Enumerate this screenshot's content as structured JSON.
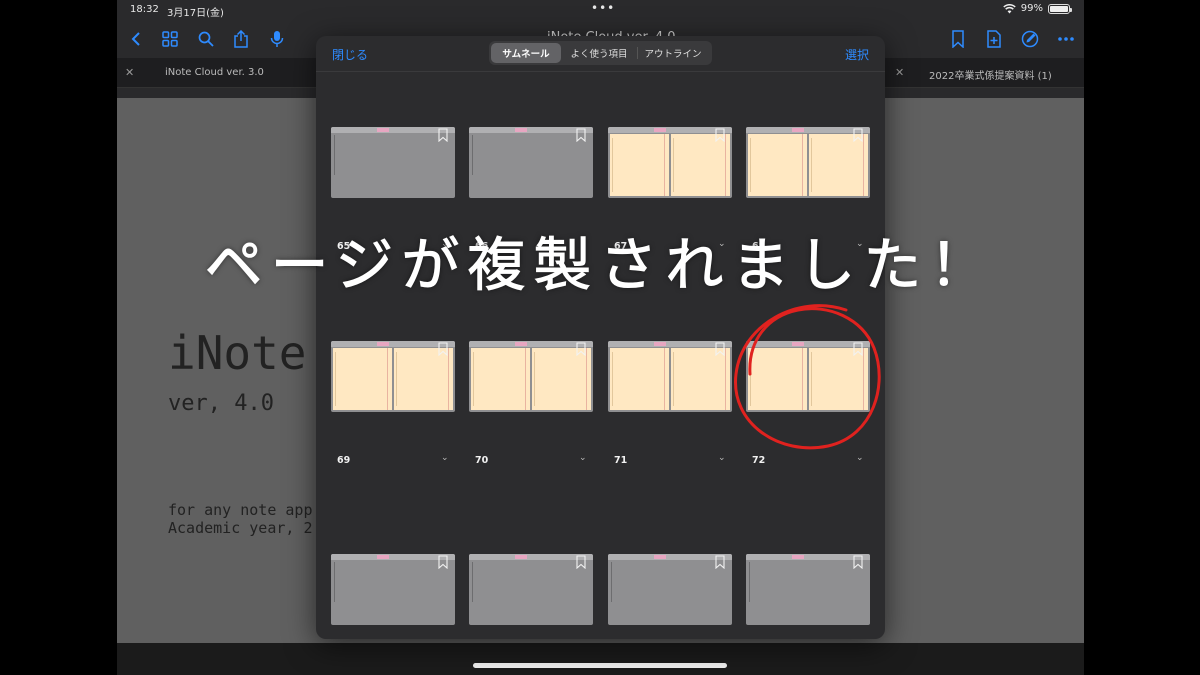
{
  "status": {
    "time": "18:32",
    "date": "3月17日(金)",
    "battery": "99%",
    "battery_level": 0.99
  },
  "toolbar": {
    "title": "iNote Cloud ver. 4.0"
  },
  "tabs": [
    {
      "label": "iNote Cloud ver. 3.0"
    },
    {
      "label": "2022卒業式係提案資料 (1)"
    }
  ],
  "document": {
    "title": "iNote",
    "version": "ver, 4.0",
    "line1": "for any note app",
    "line2": "Academic year, 2"
  },
  "panel": {
    "close_label": "閉じる",
    "select_label": "選択",
    "segments": [
      "サムネール",
      "よく使う項目",
      "アウトライン"
    ],
    "active_segment": "サムネール"
  },
  "thumbnails": [
    {
      "page": "65",
      "type": "gray"
    },
    {
      "page": "66",
      "type": "gray"
    },
    {
      "page": "67",
      "type": "spread"
    },
    {
      "page": "68",
      "type": "spread"
    },
    {
      "page": "69",
      "type": "spread"
    },
    {
      "page": "70",
      "type": "spread"
    },
    {
      "page": "71",
      "type": "spread"
    },
    {
      "page": "72",
      "type": "spread",
      "circled": true
    },
    {
      "page": "",
      "type": "gray"
    },
    {
      "page": "",
      "type": "gray"
    },
    {
      "page": "",
      "type": "gray"
    },
    {
      "page": "",
      "type": "gray"
    }
  ],
  "overlay": {
    "message": "ページが複製されました！",
    "circle_color": "#e0221f"
  },
  "colors": {
    "accent": "#2e8bff",
    "page": "#ffe8c2",
    "panel": "#2c2c2e"
  }
}
